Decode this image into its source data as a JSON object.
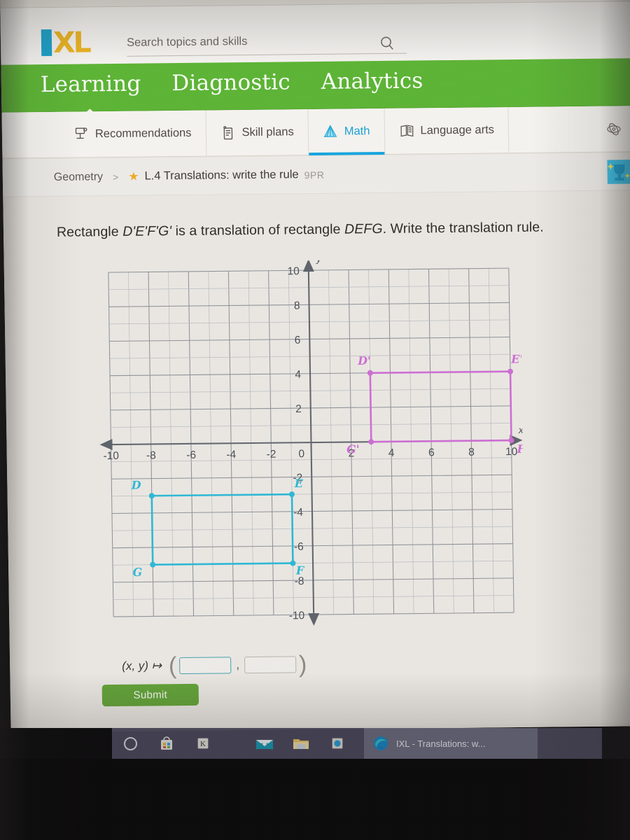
{
  "header": {
    "logo": {
      "i_text": "I",
      "xl_text": "XL",
      "blue": "#1b9fc8",
      "yellow": "#eab222"
    },
    "search": {
      "placeholder": "Search topics and skills",
      "value": "",
      "icon": "search-icon"
    }
  },
  "primary_nav": {
    "background": "#5cb335",
    "items": [
      {
        "label": "Learning",
        "active": true
      },
      {
        "label": "Diagnostic",
        "active": false
      },
      {
        "label": "Analytics",
        "active": false
      }
    ]
  },
  "sub_nav": {
    "accent": "#18a4dd",
    "items": [
      {
        "label": "Recommendations",
        "icon": "recommendations-icon",
        "active": false
      },
      {
        "label": "Skill plans",
        "icon": "skill-plans-icon",
        "active": false
      },
      {
        "label": "Math",
        "icon": "math-pyramid-icon",
        "active": true
      },
      {
        "label": "Language arts",
        "icon": "open-book-icon",
        "active": false
      }
    ],
    "right_icon": "science-atom-icon"
  },
  "breadcrumb": {
    "subject": "Geometry",
    "separator": ">",
    "star_icon": "star-icon",
    "skill": "L.4 Translations: write the rule",
    "code": "9PR",
    "trophy_icon": "trophy-awards-icon"
  },
  "question": {
    "prefix": "Rectangle ",
    "shape_image": "D'E'F'G'",
    "middle": " is a translation of rectangle ",
    "shape_preimage": "DEFG",
    "suffix": ". Write the translation rule."
  },
  "chart_data": {
    "type": "scatter",
    "title": "",
    "xlabel": "x",
    "ylabel": "y",
    "xlim": [
      -10,
      10
    ],
    "ylim": [
      -10,
      10
    ],
    "grid": true,
    "tick_step": 2,
    "x_ticks": [
      -10,
      -8,
      -6,
      -4,
      -2,
      0,
      2,
      4,
      6,
      8,
      10
    ],
    "y_ticks": [
      -10,
      -8,
      -6,
      -4,
      -2,
      2,
      4,
      6,
      8,
      10
    ],
    "origin_label": "0",
    "legend": "none",
    "series": [
      {
        "name": "DEFG",
        "color": "#2eb7d4",
        "closed": true,
        "points": [
          {
            "label": "D",
            "x": -8,
            "y": -3,
            "label_dx": -22,
            "label_dy": -10
          },
          {
            "label": "E",
            "x": -1,
            "y": -3,
            "label_dx": 10,
            "label_dy": -10
          },
          {
            "label": "F",
            "x": -1,
            "y": -7,
            "label_dx": 10,
            "label_dy": 16
          },
          {
            "label": "G",
            "x": -8,
            "y": -7,
            "label_dx": -22,
            "label_dy": 16
          }
        ]
      },
      {
        "name": "D'E'F'G'",
        "color": "#cc6ed2",
        "closed": true,
        "points": [
          {
            "label": "D'",
            "x": 3,
            "y": 4,
            "label_dx": -8,
            "label_dy": -12
          },
          {
            "label": "E'",
            "x": 10,
            "y": 4,
            "label_dx": 10,
            "label_dy": -12
          },
          {
            "label": "F'",
            "x": 10,
            "y": 0,
            "label_dx": 16,
            "label_dy": 18
          },
          {
            "label": "G'",
            "x": 3,
            "y": 0,
            "label_dx": -26,
            "label_dy": 16
          }
        ]
      }
    ]
  },
  "answer": {
    "rule_label": "(x, y) ↦",
    "open_paren": "(",
    "close_paren": ")",
    "comma": ",",
    "x_input": {
      "value": "",
      "placeholder": ""
    },
    "y_input": {
      "value": "",
      "placeholder": ""
    },
    "submit_label": "Submit",
    "submit_color": "#63a23a"
  },
  "taskbar": {
    "background": "#4e4c60",
    "items": [
      {
        "name": "cortana-circle-icon"
      },
      {
        "name": "microsoft-store-icon"
      },
      {
        "name": "kindle-k-icon"
      },
      {
        "name": "mail-icon"
      },
      {
        "name": "file-explorer-icon"
      },
      {
        "name": "photos-icon"
      }
    ],
    "active_window": {
      "icon": "edge-icon",
      "title": "IXL - Translations: w..."
    }
  }
}
